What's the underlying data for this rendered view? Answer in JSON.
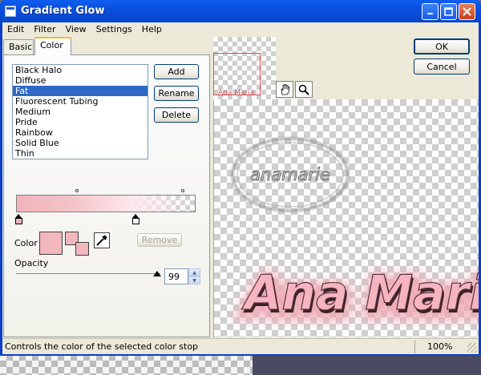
{
  "window": {
    "title": "Gradient Glow"
  },
  "menu": [
    "Edit",
    "Filter",
    "View",
    "Settings",
    "Help"
  ],
  "tabs": {
    "basic": "Basic",
    "color": "Color"
  },
  "presets": {
    "items": [
      "Black Halo",
      "Diffuse",
      "Fat",
      "Fluorescent Tubing",
      "Medium",
      "Pride",
      "Rainbow",
      "Solid Blue",
      "Thin"
    ],
    "selected": "Fat"
  },
  "buttons": {
    "add": "Add",
    "rename": "Rename",
    "delete": "Delete",
    "remove": "Remove",
    "ok": "OK",
    "cancel": "Cancel"
  },
  "color": {
    "label": "Color",
    "swatch": "#f2b8be",
    "gradient_start": "#f0b4bc"
  },
  "opacity": {
    "label": "Opacity",
    "value": "99"
  },
  "preview": {
    "thumb_text": "Ana Maria",
    "main_text": "Ana Maric",
    "watermark": "anamarie"
  },
  "status": {
    "message": "Controls the color of the selected color stop",
    "zoom": "100%"
  },
  "icons": {
    "hand": "hand-tool-icon",
    "zoom": "magnifier-icon",
    "eyedropper": "eyedropper-icon"
  }
}
